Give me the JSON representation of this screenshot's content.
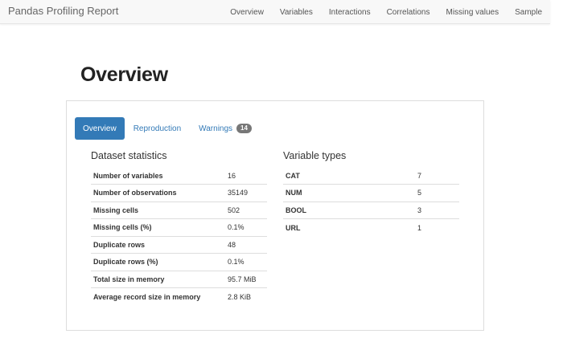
{
  "navbar": {
    "brand": "Pandas Profiling Report",
    "links": [
      "Overview",
      "Variables",
      "Interactions",
      "Correlations",
      "Missing values",
      "Sample"
    ]
  },
  "page": {
    "title": "Overview"
  },
  "tabs": {
    "overview": "Overview",
    "reproduction": "Reproduction",
    "warnings": "Warnings",
    "warnings_count": "14"
  },
  "dataset_statistics": {
    "title": "Dataset statistics",
    "rows": [
      {
        "label": "Number of variables",
        "value": "16"
      },
      {
        "label": "Number of observations",
        "value": "35149"
      },
      {
        "label": "Missing cells",
        "value": "502"
      },
      {
        "label": "Missing cells (%)",
        "value": "0.1%"
      },
      {
        "label": "Duplicate rows",
        "value": "48"
      },
      {
        "label": "Duplicate rows (%)",
        "value": "0.1%"
      },
      {
        "label": "Total size in memory",
        "value": "95.7 MiB"
      },
      {
        "label": "Average record size in memory",
        "value": "2.8 KiB"
      }
    ]
  },
  "variable_types": {
    "title": "Variable types",
    "rows": [
      {
        "label": "CAT",
        "value": "7"
      },
      {
        "label": "NUM",
        "value": "5"
      },
      {
        "label": "BOOL",
        "value": "3"
      },
      {
        "label": "URL",
        "value": "1"
      }
    ]
  },
  "colors": {
    "accent": "#337ab7",
    "badge": "#777777",
    "navbar_bg": "#f8f8f8"
  }
}
